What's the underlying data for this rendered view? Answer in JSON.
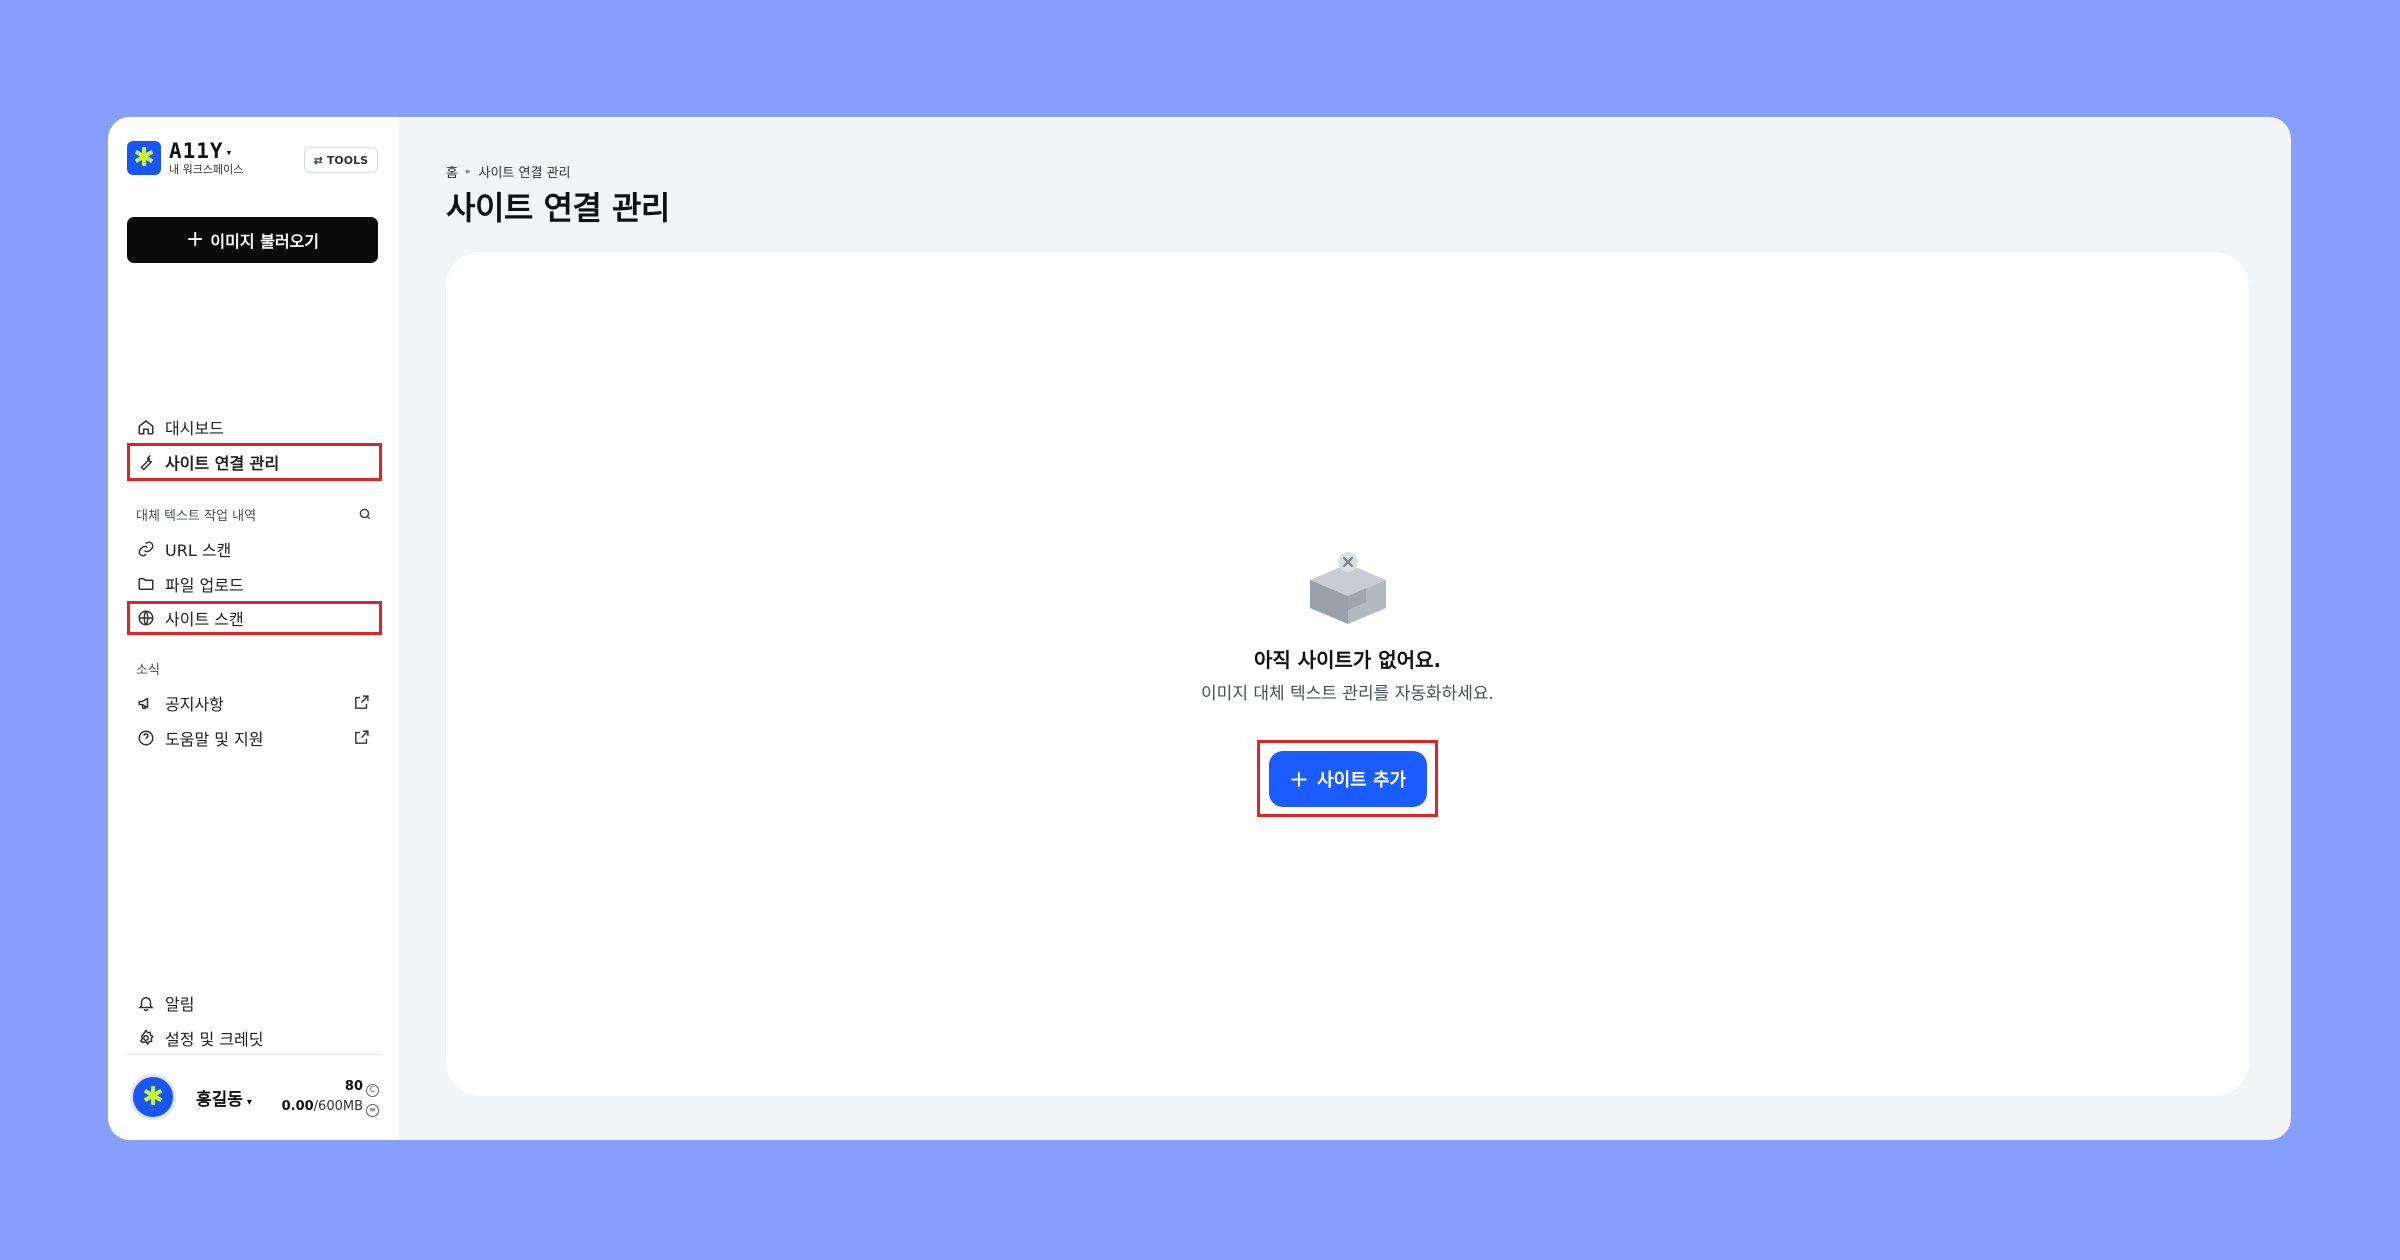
{
  "colors": {
    "page_bg": "#879ffc",
    "brand_blue": "#1a56f5",
    "primary_button": "#1a5cff",
    "highlight_outline": "#e02424",
    "logo_accent": "#c7f43a"
  },
  "sidebar": {
    "brand": {
      "name": "A11Y",
      "workspace": "내 워크스페이스",
      "logo_icon": "sparkle-icon"
    },
    "tools_label": "TOOLS",
    "import_button": "이미지 불러오기",
    "nav_main": [
      {
        "label": "대시보드",
        "icon": "home-icon"
      },
      {
        "label": "사이트 연결 관리",
        "icon": "wrench-icon"
      }
    ],
    "history_section": {
      "label": "대체 텍스트 작업 내역",
      "items": [
        {
          "label": "URL 스캔",
          "icon": "link-icon"
        },
        {
          "label": "파일 업로드",
          "icon": "folder-icon"
        },
        {
          "label": "사이트 스캔",
          "icon": "globe-icon"
        }
      ]
    },
    "news_section": {
      "label": "소식",
      "items": [
        {
          "label": "공지사항",
          "icon": "megaphone-icon"
        },
        {
          "label": "도움말 및 지원",
          "icon": "help-circle-icon"
        }
      ]
    },
    "bottom_items": [
      {
        "label": "알림",
        "icon": "bell-icon"
      },
      {
        "label": "설정 및 크레딧",
        "icon": "gear-icon"
      }
    ],
    "user": {
      "name": "홍길동",
      "credits": "80",
      "storage_used": "0.00",
      "storage_total": "/600MB"
    }
  },
  "main": {
    "breadcrumb": [
      "홈",
      "사이트 연결 관리"
    ],
    "title": "사이트 연결 관리",
    "empty_state": {
      "icon": "empty-box-icon",
      "title": "아직 사이트가 없어요.",
      "subtitle": "이미지 대체 텍스트 관리를 자동화하세요.",
      "button_label": "사이트 추가"
    }
  }
}
